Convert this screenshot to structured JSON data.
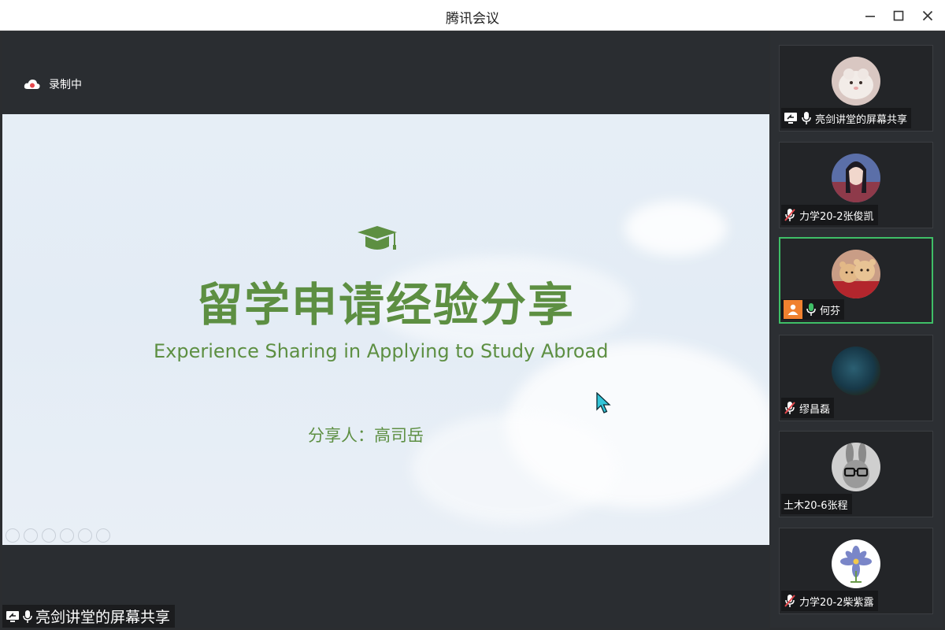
{
  "window": {
    "title": "腾讯会议"
  },
  "recording": {
    "label": "录制中"
  },
  "slide": {
    "title": "留学申请经验分享",
    "subtitle": "Experience Sharing in Applying to Study Abroad",
    "presenter": "分享人：高司岳"
  },
  "share": {
    "label": "亮剑讲堂的屏幕共享"
  },
  "participants": [
    {
      "name": "亮剑讲堂的屏幕共享",
      "mic": "on",
      "screen_share": true
    },
    {
      "name": "力学20-2张俊凯",
      "mic": "muted"
    },
    {
      "name": "何芬",
      "mic": "active",
      "host_badge": true
    },
    {
      "name": "缪昌磊",
      "mic": "muted"
    },
    {
      "name": "土木20-6张程",
      "mic": "none"
    },
    {
      "name": "力学20-2柴紫露",
      "mic": "muted"
    }
  ],
  "colors": {
    "accent_green": "#5d8f42",
    "active_speaker": "#3fbf67",
    "background": "#2b2d30"
  }
}
